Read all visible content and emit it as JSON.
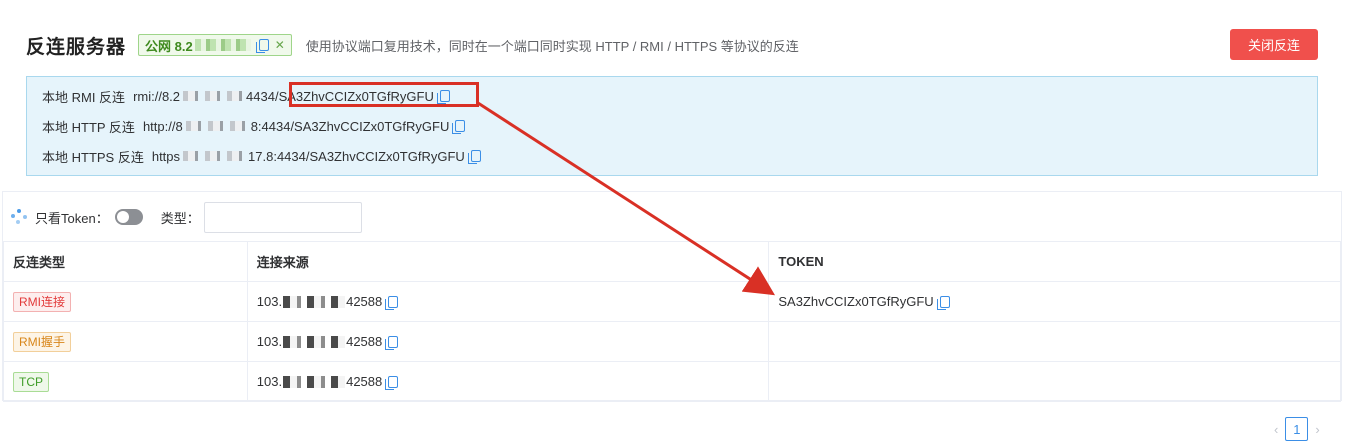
{
  "header": {
    "title": "反连服务器",
    "ip_prefix": "公网 8.2",
    "description": "使用协议端口复用技术，同时在一个端口同时实现 HTTP / RMI / HTTPS 等协议的反连",
    "close_button": "关闭反连"
  },
  "info": [
    {
      "label": "本地 RMI 反连",
      "url_start": "rmi://8.2",
      "url_end": "4434/SA3ZhvCCIZx0TGfRyGFU"
    },
    {
      "label": "本地 HTTP 反连",
      "url_start": "http://8",
      "url_end": "8:4434/SA3ZhvCCIZx0TGfRyGFU"
    },
    {
      "label": "本地 HTTPS 反连",
      "url_start": "https",
      "url_end": "17.8:4434/SA3ZhvCCIZx0TGfRyGFU"
    }
  ],
  "filter": {
    "token_only_label": "只看Token：",
    "type_label": "类型："
  },
  "table": {
    "columns": [
      "反连类型",
      "连接来源",
      "TOKEN"
    ],
    "rows": [
      {
        "type": "RMI连接",
        "tag_color": "red",
        "src_prefix": "103.",
        "src_suffix": "42588",
        "token": "SA3ZhvCCIZx0TGfRyGFU"
      },
      {
        "type": "RMI握手",
        "tag_color": "orange",
        "src_prefix": "103.",
        "src_suffix": "42588",
        "token": ""
      },
      {
        "type": "TCP",
        "tag_color": "green",
        "src_prefix": "103.",
        "src_suffix": "42588",
        "token": ""
      }
    ]
  },
  "pager": {
    "prev": "‹",
    "current": "1",
    "next": "›"
  },
  "colors": {
    "accent": "#3b8ee6",
    "danger": "#f0504c",
    "annotation": "#d93025"
  }
}
